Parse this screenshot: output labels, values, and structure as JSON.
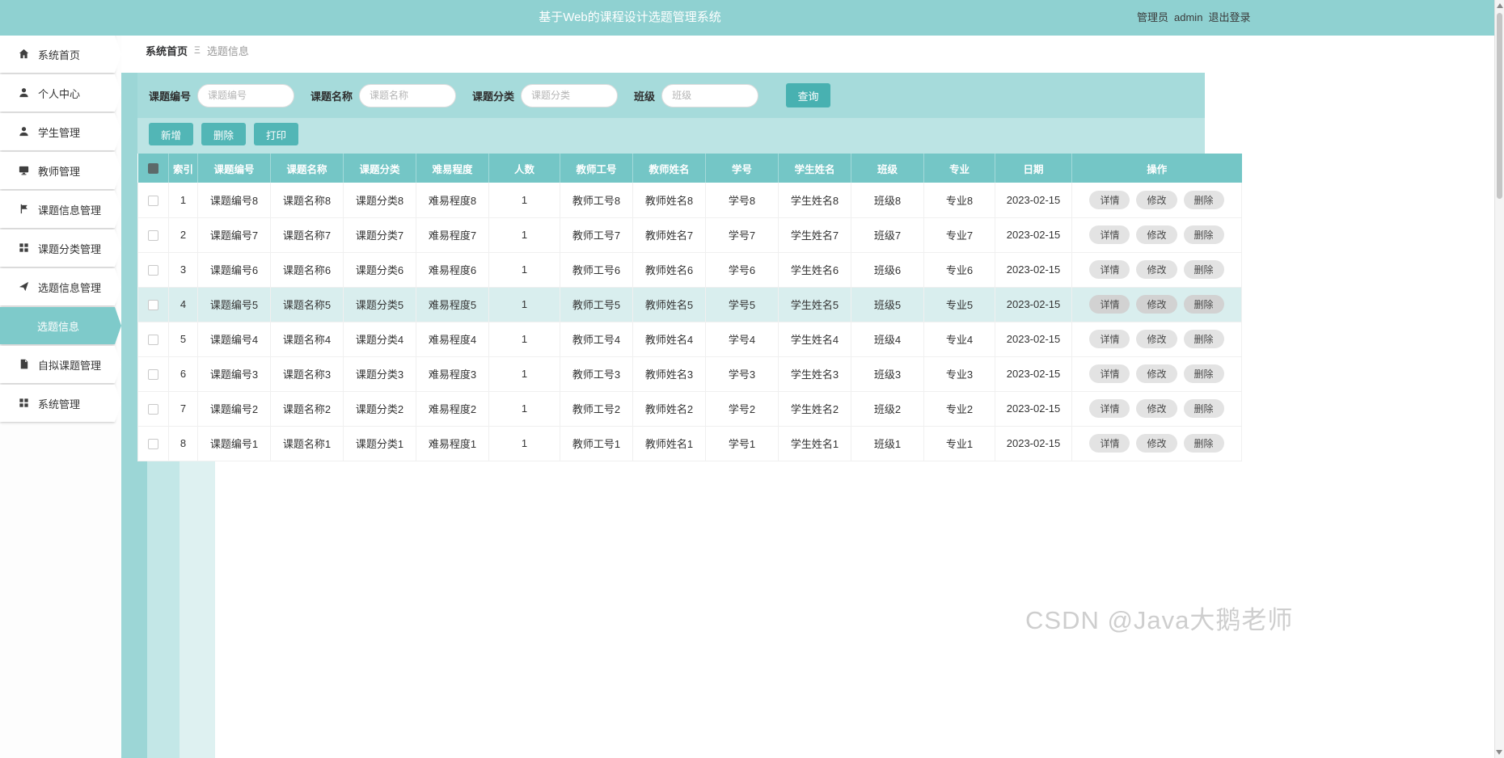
{
  "header": {
    "title": "基于Web的课程设计选题管理系统",
    "user_role": "管理员",
    "username": "admin",
    "logout_label": "退出登录"
  },
  "sidebar": {
    "items": [
      {
        "id": "home",
        "label": "系统首页",
        "icon": "home-icon"
      },
      {
        "id": "profile",
        "label": "个人中心",
        "icon": "user-icon"
      },
      {
        "id": "student-management",
        "label": "学生管理",
        "icon": "user-icon"
      },
      {
        "id": "teacher-management",
        "label": "教师管理",
        "icon": "desktop-icon"
      },
      {
        "id": "topic-info-management",
        "label": "课题信息管理",
        "icon": "flag-icon"
      },
      {
        "id": "topic-category-management",
        "label": "课题分类管理",
        "icon": "grid-icon"
      },
      {
        "id": "topic-selection-management",
        "label": "选题信息管理",
        "icon": "send-icon"
      },
      {
        "id": "topic-selection-info",
        "label": "选题信息",
        "icon": "",
        "sub": true,
        "active": true
      },
      {
        "id": "self-proposed-topic-management",
        "label": "自拟课题管理",
        "icon": "document-icon"
      },
      {
        "id": "system-management",
        "label": "系统管理",
        "icon": "grid-icon"
      }
    ]
  },
  "breadcrumb": {
    "home": "系统首页",
    "separator": "Ξ",
    "current": "选题信息"
  },
  "filters": [
    {
      "label": "课题编号",
      "placeholder": "课题编号"
    },
    {
      "label": "课题名称",
      "placeholder": "课题名称"
    },
    {
      "label": "课题分类",
      "placeholder": "课题分类"
    },
    {
      "label": "班级",
      "placeholder": "班级"
    }
  ],
  "search_button_label": "查询",
  "toolbar": {
    "add_label": "新增",
    "delete_label": "删除",
    "print_label": "打印"
  },
  "table": {
    "select_all_checked": true,
    "highlighted_row_index": 4,
    "columns": [
      "索引",
      "课题编号",
      "课题名称",
      "课题分类",
      "难易程度",
      "人数",
      "教师工号",
      "教师姓名",
      "学号",
      "学生姓名",
      "班级",
      "专业",
      "日期",
      "操作"
    ],
    "row_actions": [
      {
        "id": "detail",
        "label": "详情"
      },
      {
        "id": "edit",
        "label": "修改"
      },
      {
        "id": "delete",
        "label": "删除"
      }
    ],
    "rows": [
      {
        "index": 1,
        "cells": [
          "课题编号8",
          "课题名称8",
          "课题分类8",
          "难易程度8",
          "1",
          "教师工号8",
          "教师姓名8",
          "学号8",
          "学生姓名8",
          "班级8",
          "专业8",
          "2023-02-15"
        ]
      },
      {
        "index": 2,
        "cells": [
          "课题编号7",
          "课题名称7",
          "课题分类7",
          "难易程度7",
          "1",
          "教师工号7",
          "教师姓名7",
          "学号7",
          "学生姓名7",
          "班级7",
          "专业7",
          "2023-02-15"
        ]
      },
      {
        "index": 3,
        "cells": [
          "课题编号6",
          "课题名称6",
          "课题分类6",
          "难易程度6",
          "1",
          "教师工号6",
          "教师姓名6",
          "学号6",
          "学生姓名6",
          "班级6",
          "专业6",
          "2023-02-15"
        ]
      },
      {
        "index": 4,
        "cells": [
          "课题编号5",
          "课题名称5",
          "课题分类5",
          "难易程度5",
          "1",
          "教师工号5",
          "教师姓名5",
          "学号5",
          "学生姓名5",
          "班级5",
          "专业5",
          "2023-02-15"
        ]
      },
      {
        "index": 5,
        "cells": [
          "课题编号4",
          "课题名称4",
          "课题分类4",
          "难易程度4",
          "1",
          "教师工号4",
          "教师姓名4",
          "学号4",
          "学生姓名4",
          "班级4",
          "专业4",
          "2023-02-15"
        ]
      },
      {
        "index": 6,
        "cells": [
          "课题编号3",
          "课题名称3",
          "课题分类3",
          "难易程度3",
          "1",
          "教师工号3",
          "教师姓名3",
          "学号3",
          "学生姓名3",
          "班级3",
          "专业3",
          "2023-02-15"
        ]
      },
      {
        "index": 7,
        "cells": [
          "课题编号2",
          "课题名称2",
          "课题分类2",
          "难易程度2",
          "1",
          "教师工号2",
          "教师姓名2",
          "学号2",
          "学生姓名2",
          "班级2",
          "专业2",
          "2023-02-15"
        ]
      },
      {
        "index": 8,
        "cells": [
          "课题编号1",
          "课题名称1",
          "课题分类1",
          "难易程度1",
          "1",
          "教师工号1",
          "教师姓名1",
          "学号1",
          "学生姓名1",
          "班级1",
          "专业1",
          "2023-02-15"
        ]
      }
    ]
  },
  "watermark": "CSDN @Java大鹅老师",
  "colors": {
    "header_teal": "#8fd1d1",
    "panel_teal": "#a6dbdb",
    "toolbar_teal": "#bce4e4",
    "table_header_teal": "#74c6c6",
    "button_teal": "#52b6b6",
    "hover_row": "#d9eeee",
    "active_menu": "#7ecaca"
  }
}
